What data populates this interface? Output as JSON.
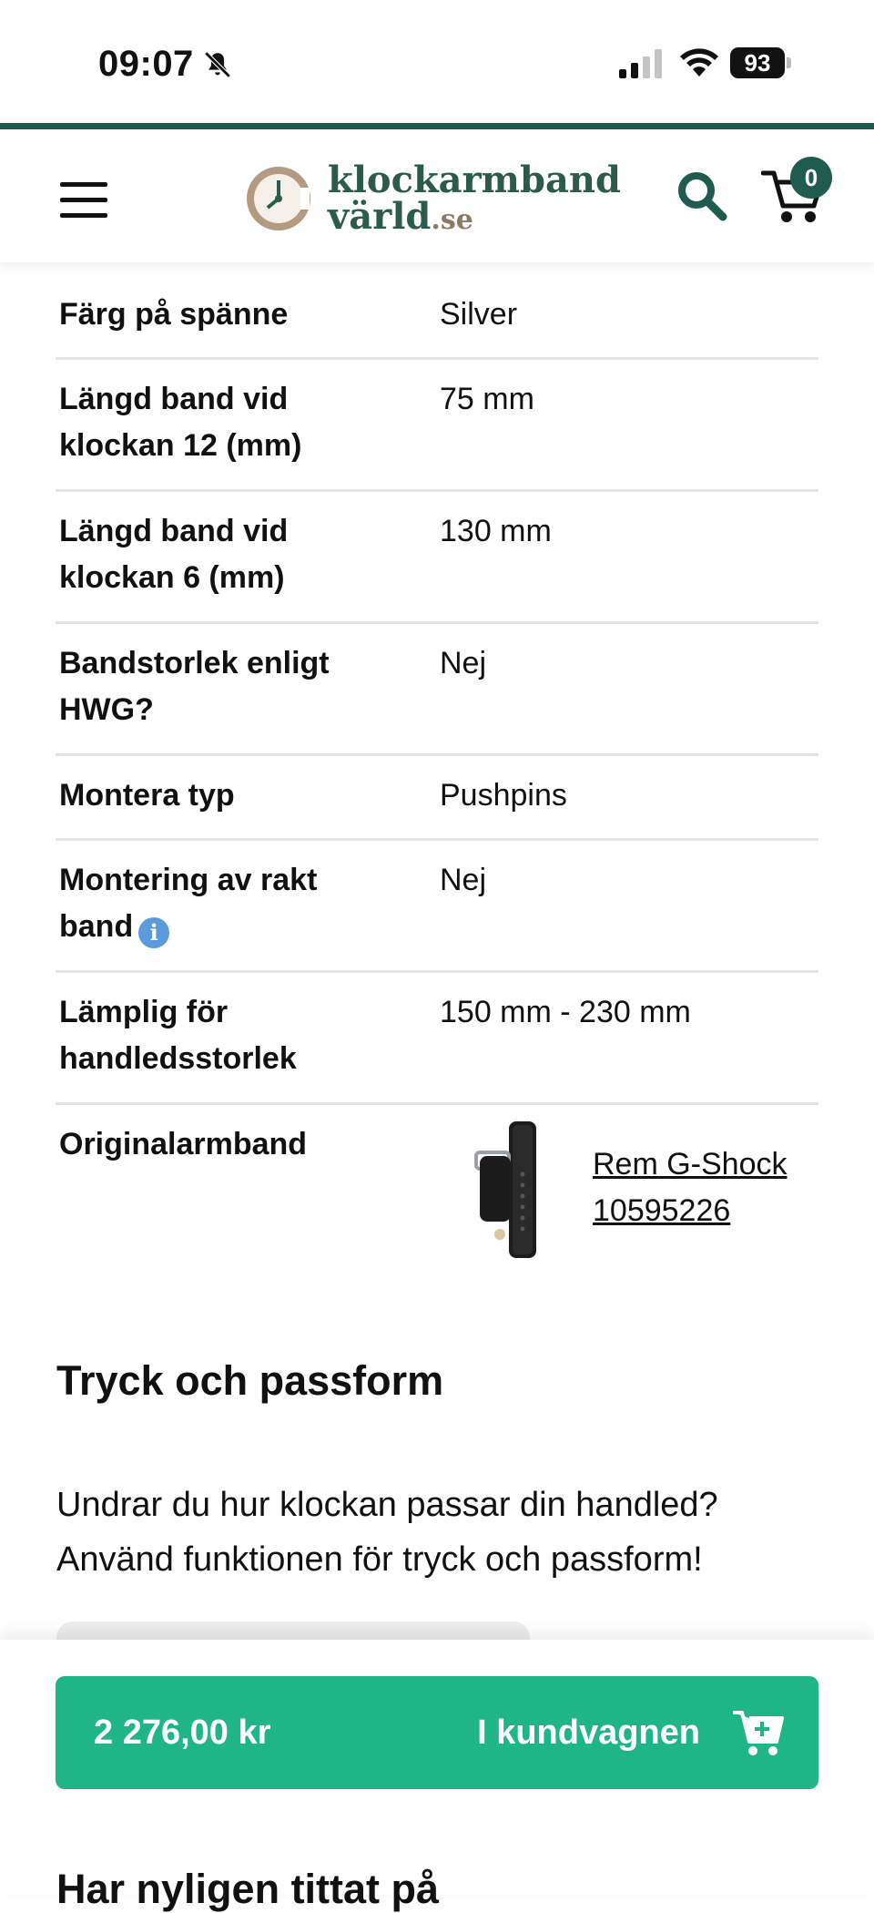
{
  "status_bar": {
    "time": "09:07",
    "battery": "93",
    "icons": [
      "bell-slash-icon",
      "cellular-signal-icon",
      "wifi-icon",
      "battery-icon"
    ]
  },
  "header": {
    "logo_line1": "klockarmband",
    "logo_line2": "värld",
    "logo_tld": ".se",
    "cart_count": "0",
    "icons": [
      "hamburger-menu-icon",
      "search-icon",
      "cart-icon"
    ],
    "accent_color": "#1f5b4f"
  },
  "specs": [
    {
      "label": "Färg på spänne",
      "value": "Silver"
    },
    {
      "label": "Längd band vid klockan 12 (mm)",
      "value": "75 mm"
    },
    {
      "label": "Längd band vid klockan 6 (mm)",
      "value": "130 mm"
    },
    {
      "label": "Bandstorlek enligt HWG?",
      "value": "Nej"
    },
    {
      "label": "Montera typ",
      "value": "Pushpins"
    },
    {
      "label": "Montering av rakt band",
      "value": "Nej",
      "info_icon": "i"
    },
    {
      "label": "Lämplig för handledsstorlek",
      "value": "150 mm - 230 mm"
    },
    {
      "label": "Originalarmband",
      "link_text": "Rem G-Shock 10595226"
    }
  ],
  "fit_section": {
    "title": "Tryck och passform",
    "text": "Undrar du hur klockan passar din handled? Använd funktionen för tryck och passform!"
  },
  "buy_bar": {
    "price": "2 276,00 kr",
    "button_label": "I kundvagnen",
    "button_color": "#1fb587"
  },
  "recent": {
    "title": "Har nyligen tittat på"
  }
}
